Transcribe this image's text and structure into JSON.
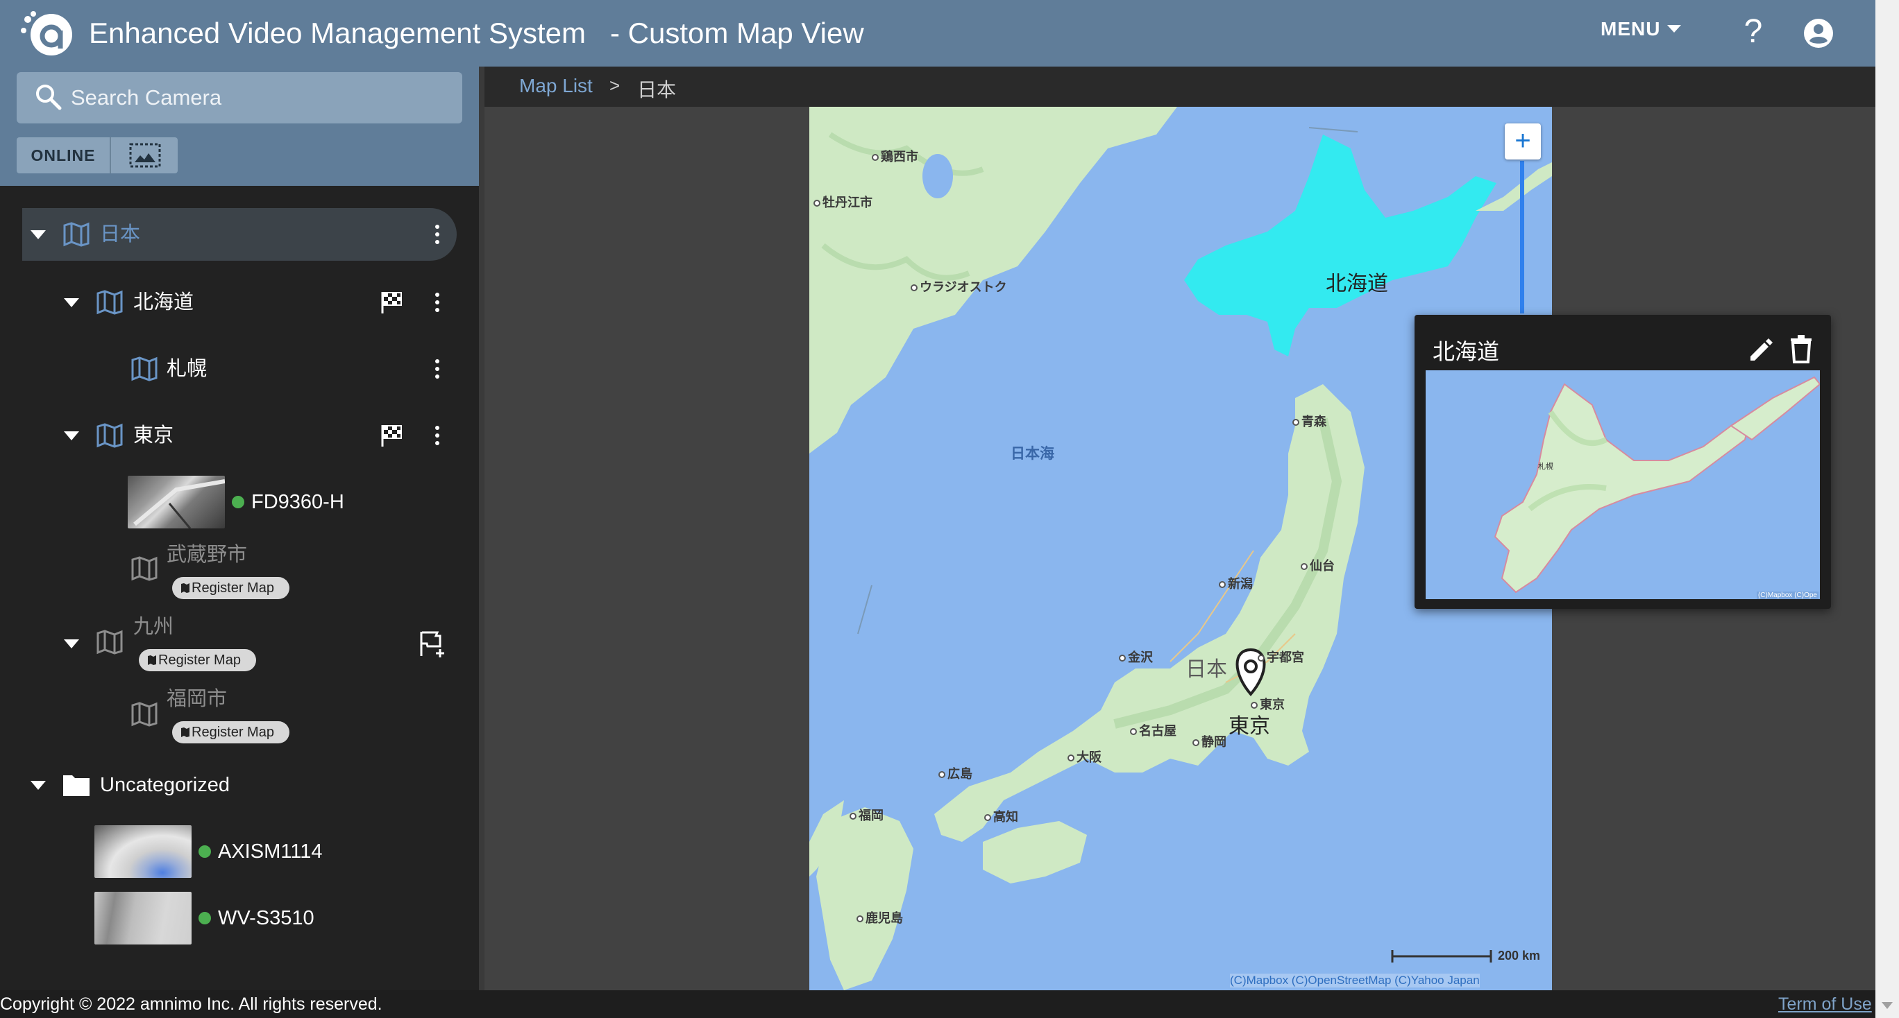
{
  "header": {
    "title": "Enhanced Video Management System",
    "subtitle": "- Custom Map View",
    "menu_label": "MENU",
    "help_label": "?"
  },
  "sidebar": {
    "search_placeholder": "Search Camera",
    "filter_online_label": "ONLINE",
    "register_map_label": "Register Map",
    "tree": {
      "root": "日本",
      "hokkaido": "北海道",
      "sapporo": "札幌",
      "tokyo": "東京",
      "camera1": "FD9360-H",
      "musashino": "武蔵野市",
      "kyushu": "九州",
      "fukuoka": "福岡市",
      "uncategorized": "Uncategorized",
      "camera2": "AXISM1114",
      "camera3": "WV-S3510"
    }
  },
  "breadcrumb": {
    "link": "Map List",
    "separator": ">",
    "current": "日本"
  },
  "map": {
    "labels": {
      "country": "日本",
      "hokkaido": "北海道",
      "tokyo_marker": "東京",
      "sea": "日本海",
      "jixi": "鶏西市",
      "mudanjiang": "牡丹江市",
      "vladivostok": "ウラジオストク",
      "aomori": "青森",
      "sendai": "仙台",
      "niigata": "新潟",
      "kanazawa": "金沢",
      "utsunomiya": "宇都宮",
      "tokyo": "東京",
      "nagoya": "名古屋",
      "shizuoka": "静岡",
      "osaka": "大阪",
      "hiroshima": "広島",
      "kochi": "高知",
      "fukuoka": "福岡",
      "kagoshima": "鹿児島"
    },
    "zoom_in_label": "+",
    "scale_label": "200 km",
    "attribution": "(C)Mapbox  (C)OpenStreetMap  (C)Yahoo Japan"
  },
  "popup": {
    "title": "北海道",
    "mini_label": "札幌",
    "attribution": "(C)Mapbox (C)Ope"
  },
  "footer": {
    "copyright": "Copyright © 2022 amnimo Inc. All rights reserved.",
    "terms": "Term of Use"
  },
  "colors": {
    "header": "#607d99",
    "sidebar": "#222222",
    "highlight_region": "#33eaf0",
    "water": "#8ab6ee",
    "land": "#cfe9c4",
    "online": "#4caf50"
  }
}
